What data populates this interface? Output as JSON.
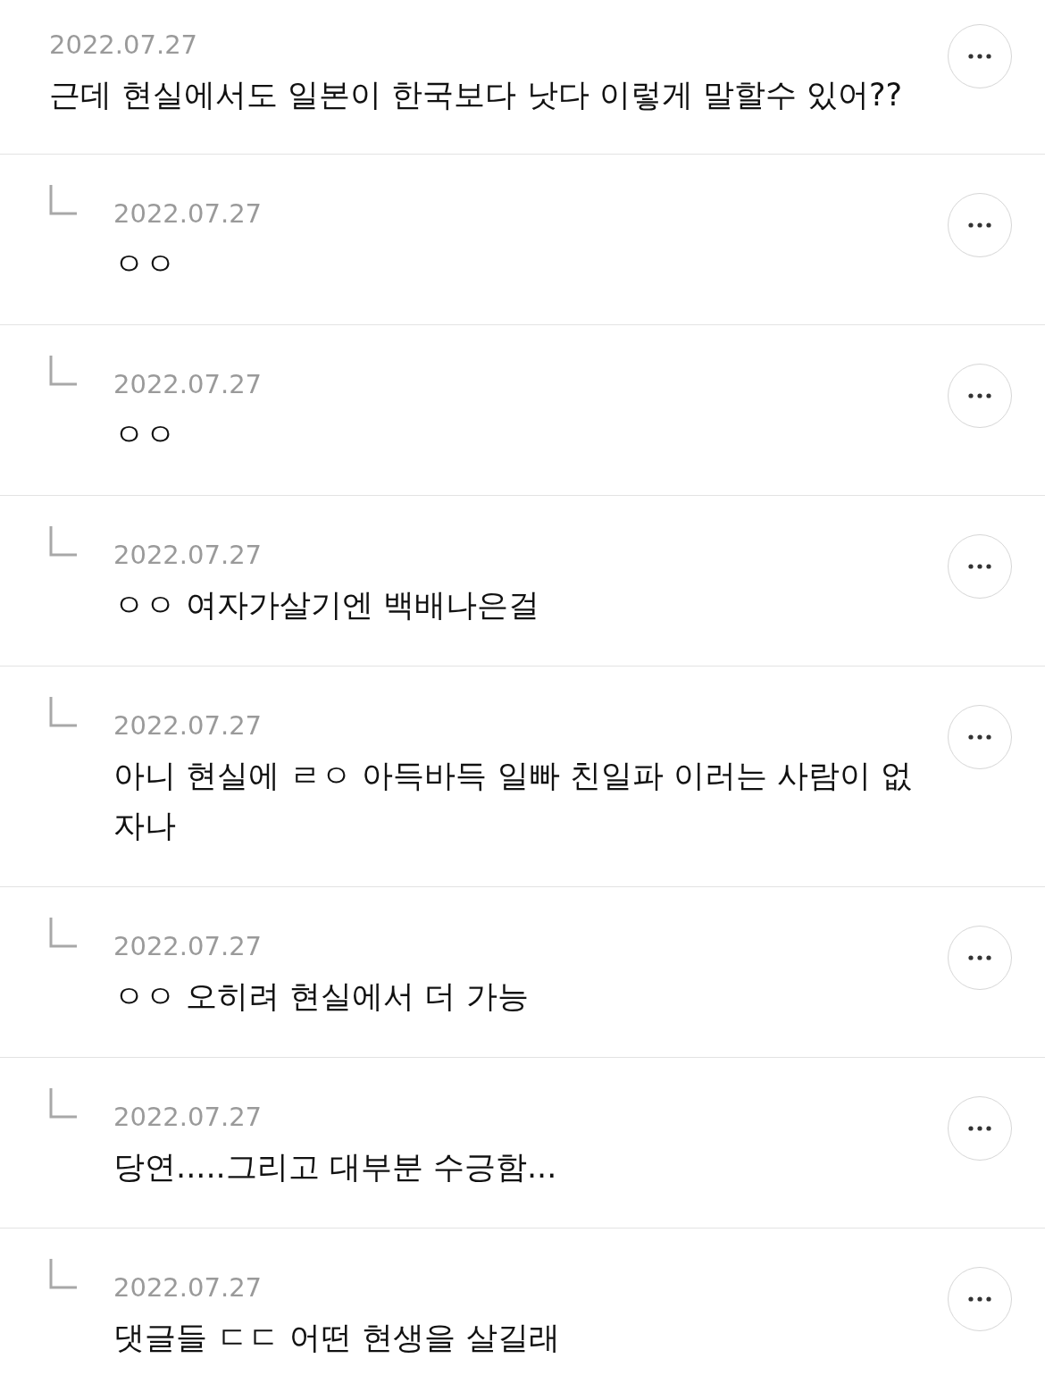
{
  "comments": [
    {
      "kind": "comment",
      "date": "2022.07.27",
      "text": "근데 현실에서도 일본이 한국보다 낫다 이렇게 말할수 있어??"
    },
    {
      "kind": "reply",
      "date": "2022.07.27",
      "text": "ㅇㅇ"
    },
    {
      "kind": "reply",
      "date": "2022.07.27",
      "text": "ㅇㅇ"
    },
    {
      "kind": "reply",
      "date": "2022.07.27",
      "text": "ㅇㅇ 여자가살기엔 백배나은걸"
    },
    {
      "kind": "reply",
      "date": "2022.07.27",
      "text": "아니 현실에 ㄹㅇ 아득바득 일빠 친일파 이러는 사람이 없자나"
    },
    {
      "kind": "reply",
      "date": "2022.07.27",
      "text": "ㅇㅇ 오히려 현실에서 더 가능"
    },
    {
      "kind": "reply",
      "date": "2022.07.27",
      "text": "당연.....그리고 대부분 수긍함..."
    },
    {
      "kind": "reply",
      "date": "2022.07.27",
      "text": "댓글들 ㄷㄷ 어떤 현생을 살길래"
    }
  ]
}
